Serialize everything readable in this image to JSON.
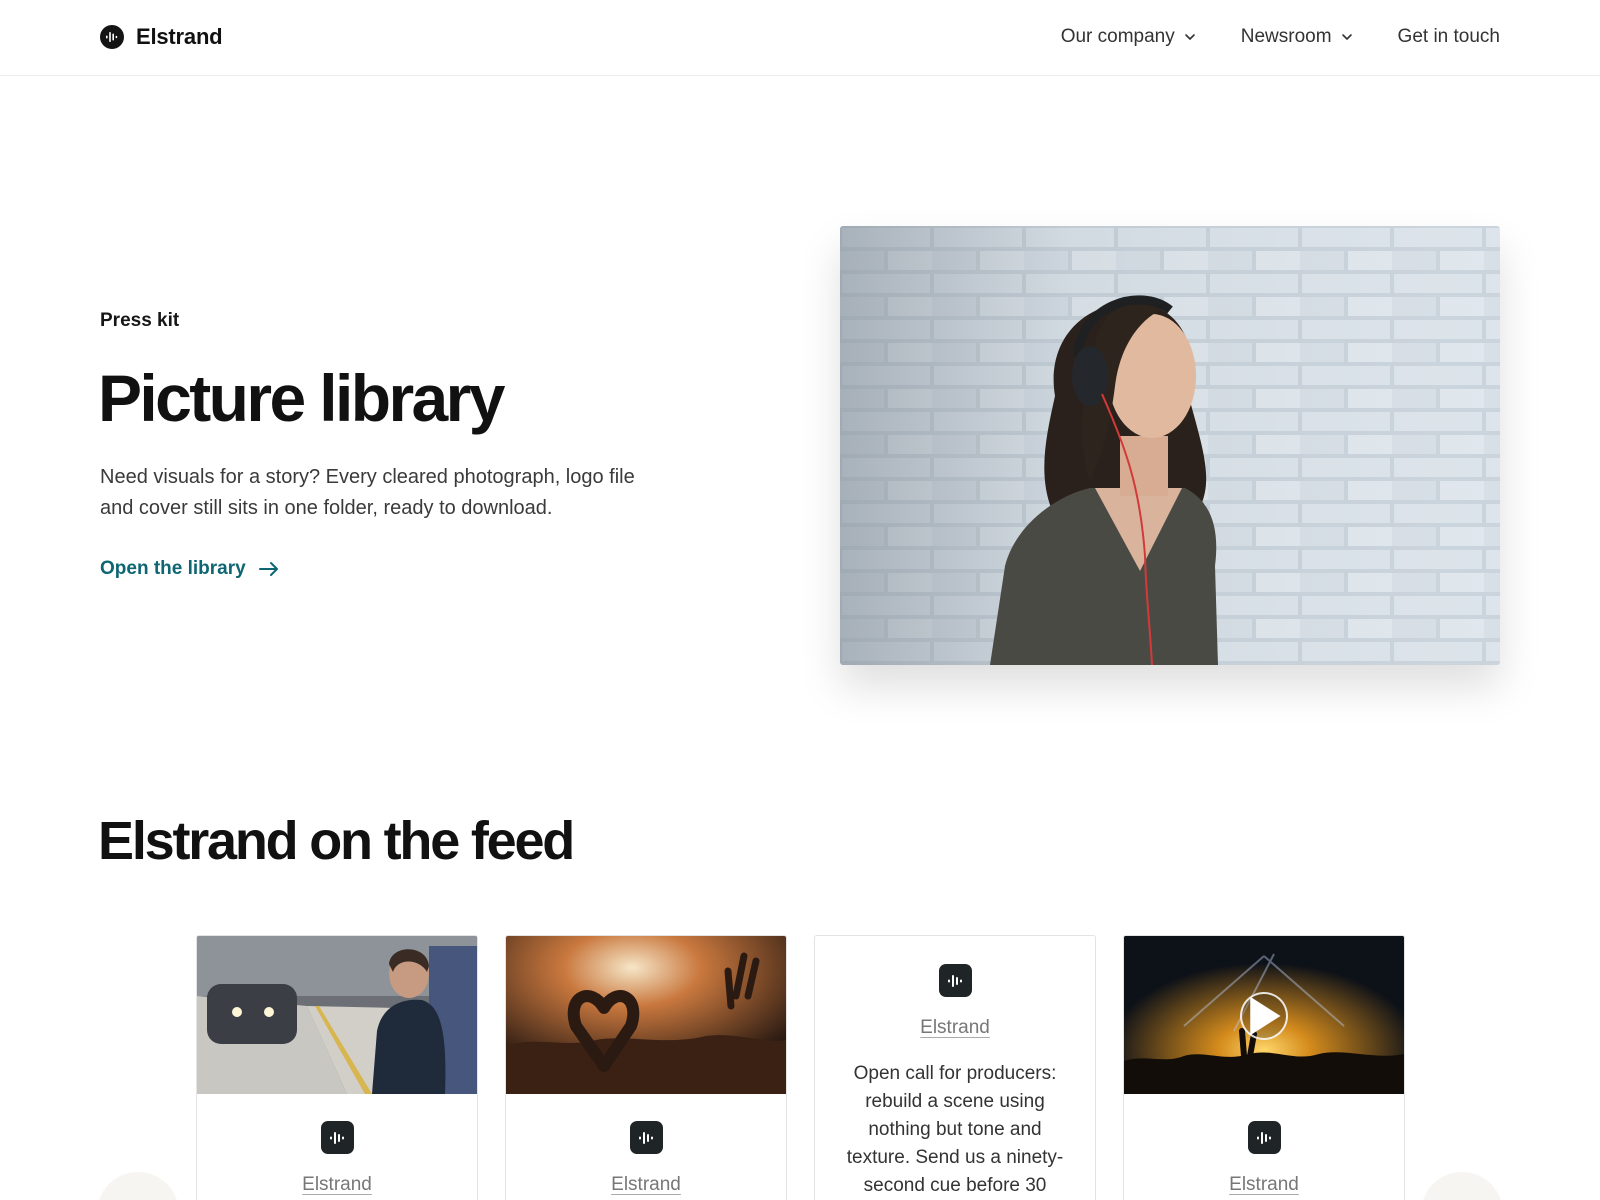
{
  "header": {
    "brand": "Elstrand",
    "nav": [
      {
        "label": "Our company",
        "has_dropdown": true
      },
      {
        "label": "Newsroom",
        "has_dropdown": true
      },
      {
        "label": "Get in touch",
        "has_dropdown": false
      }
    ]
  },
  "hero": {
    "eyebrow": "Press kit",
    "title": "Picture library",
    "description": "Need visuals for a story? Every cleared photograph, logo file and cover still sits in one folder, ready to download.",
    "link_label": "Open the library",
    "accent_color": "#0e6672"
  },
  "feed": {
    "title": "Elstrand on the feed",
    "cards": [
      {
        "type": "photo",
        "author": "Elstrand",
        "media": "subway-listener-photo"
      },
      {
        "type": "photo",
        "author": "Elstrand",
        "media": "concert-heart-hands-photo"
      },
      {
        "type": "text",
        "author": "Elstrand",
        "text": "Open call for producers: rebuild a scene using nothing but tone and texture. Send us a ninety-second cue before 30"
      },
      {
        "type": "video",
        "author": "Elstrand",
        "media": "stage-crowd-video"
      }
    ]
  },
  "icons": {
    "brand": "waveform-logo-icon",
    "dropdown": "chevron-down-icon",
    "link": "arrow-right-icon",
    "badge": "waveform-badge-icon",
    "video": "play-icon"
  }
}
